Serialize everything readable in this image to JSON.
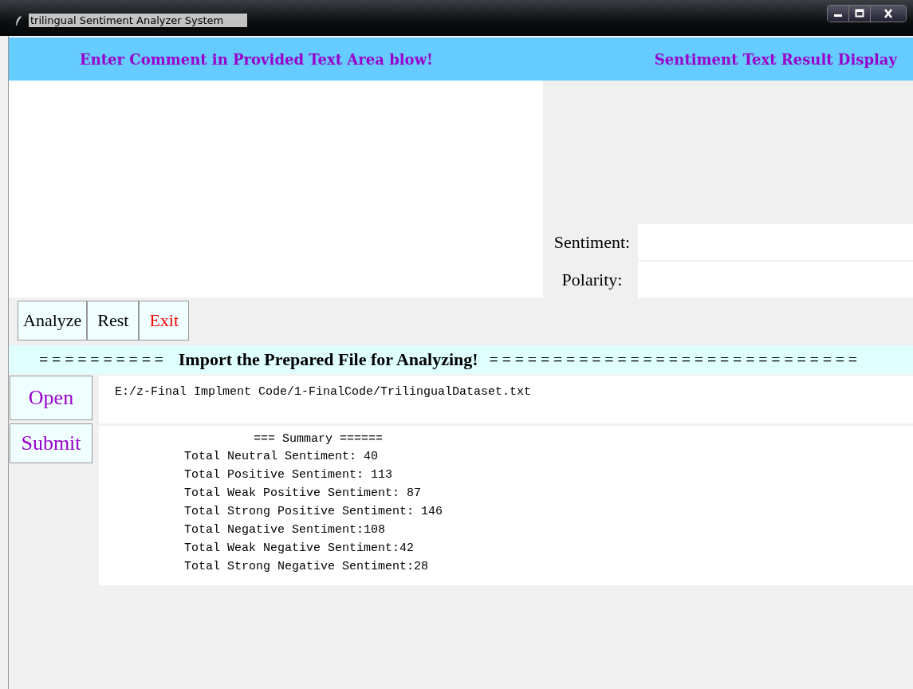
{
  "window": {
    "title": "trilingual Sentiment Analyzer System"
  },
  "header": {
    "left": "Enter Comment in Provided Text Area blow!",
    "right": "Sentiment Text Result Display"
  },
  "result_fields": [
    {
      "label": "Sentiment:"
    },
    {
      "label": "Polarity:"
    }
  ],
  "buttons": [
    {
      "label": "Analyze",
      "color": "#000000"
    },
    {
      "label": "Rest",
      "color": "#000000"
    },
    {
      "label": "Exit",
      "color": "#ff0000"
    }
  ],
  "import_banner": {
    "left_rule": "==========",
    "title": "Import the Prepared File for Analyzing!",
    "right_rule": "============================="
  },
  "file_buttons": [
    {
      "label": "Open",
      "color": "#9900cc"
    },
    {
      "label": "Submit",
      "color": "#9900cc"
    }
  ],
  "file_path": "E:/z-Final Implment Code/1-FinalCode/TrilingualDataset.txt",
  "summary": {
    "heading": "=== Summary ======",
    "lines": [
      "Total Neutral Sentiment: 40",
      "Total Positive Sentiment: 113",
      "Total Weak Positive Sentiment: 87",
      "Total Strong Positive Sentiment: 146",
      "Total Negative Sentiment:108",
      "Total Weak Negative Sentiment:42",
      "Total Strong Negative Sentiment:28"
    ]
  }
}
